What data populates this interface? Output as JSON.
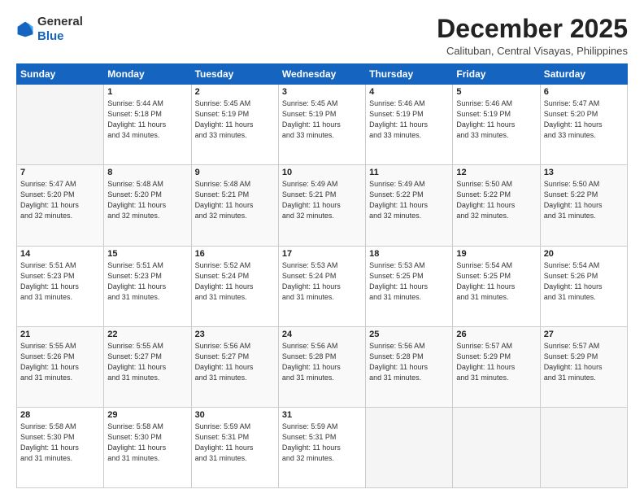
{
  "logo": {
    "general": "General",
    "blue": "Blue"
  },
  "title": "December 2025",
  "location": "Calituban, Central Visayas, Philippines",
  "days_header": [
    "Sunday",
    "Monday",
    "Tuesday",
    "Wednesday",
    "Thursday",
    "Friday",
    "Saturday"
  ],
  "weeks": [
    [
      {
        "day": "",
        "info": ""
      },
      {
        "day": "1",
        "info": "Sunrise: 5:44 AM\nSunset: 5:18 PM\nDaylight: 11 hours\nand 34 minutes."
      },
      {
        "day": "2",
        "info": "Sunrise: 5:45 AM\nSunset: 5:19 PM\nDaylight: 11 hours\nand 33 minutes."
      },
      {
        "day": "3",
        "info": "Sunrise: 5:45 AM\nSunset: 5:19 PM\nDaylight: 11 hours\nand 33 minutes."
      },
      {
        "day": "4",
        "info": "Sunrise: 5:46 AM\nSunset: 5:19 PM\nDaylight: 11 hours\nand 33 minutes."
      },
      {
        "day": "5",
        "info": "Sunrise: 5:46 AM\nSunset: 5:19 PM\nDaylight: 11 hours\nand 33 minutes."
      },
      {
        "day": "6",
        "info": "Sunrise: 5:47 AM\nSunset: 5:20 PM\nDaylight: 11 hours\nand 33 minutes."
      }
    ],
    [
      {
        "day": "7",
        "info": "Sunrise: 5:47 AM\nSunset: 5:20 PM\nDaylight: 11 hours\nand 32 minutes."
      },
      {
        "day": "8",
        "info": "Sunrise: 5:48 AM\nSunset: 5:20 PM\nDaylight: 11 hours\nand 32 minutes."
      },
      {
        "day": "9",
        "info": "Sunrise: 5:48 AM\nSunset: 5:21 PM\nDaylight: 11 hours\nand 32 minutes."
      },
      {
        "day": "10",
        "info": "Sunrise: 5:49 AM\nSunset: 5:21 PM\nDaylight: 11 hours\nand 32 minutes."
      },
      {
        "day": "11",
        "info": "Sunrise: 5:49 AM\nSunset: 5:22 PM\nDaylight: 11 hours\nand 32 minutes."
      },
      {
        "day": "12",
        "info": "Sunrise: 5:50 AM\nSunset: 5:22 PM\nDaylight: 11 hours\nand 32 minutes."
      },
      {
        "day": "13",
        "info": "Sunrise: 5:50 AM\nSunset: 5:22 PM\nDaylight: 11 hours\nand 31 minutes."
      }
    ],
    [
      {
        "day": "14",
        "info": "Sunrise: 5:51 AM\nSunset: 5:23 PM\nDaylight: 11 hours\nand 31 minutes."
      },
      {
        "day": "15",
        "info": "Sunrise: 5:51 AM\nSunset: 5:23 PM\nDaylight: 11 hours\nand 31 minutes."
      },
      {
        "day": "16",
        "info": "Sunrise: 5:52 AM\nSunset: 5:24 PM\nDaylight: 11 hours\nand 31 minutes."
      },
      {
        "day": "17",
        "info": "Sunrise: 5:53 AM\nSunset: 5:24 PM\nDaylight: 11 hours\nand 31 minutes."
      },
      {
        "day": "18",
        "info": "Sunrise: 5:53 AM\nSunset: 5:25 PM\nDaylight: 11 hours\nand 31 minutes."
      },
      {
        "day": "19",
        "info": "Sunrise: 5:54 AM\nSunset: 5:25 PM\nDaylight: 11 hours\nand 31 minutes."
      },
      {
        "day": "20",
        "info": "Sunrise: 5:54 AM\nSunset: 5:26 PM\nDaylight: 11 hours\nand 31 minutes."
      }
    ],
    [
      {
        "day": "21",
        "info": "Sunrise: 5:55 AM\nSunset: 5:26 PM\nDaylight: 11 hours\nand 31 minutes."
      },
      {
        "day": "22",
        "info": "Sunrise: 5:55 AM\nSunset: 5:27 PM\nDaylight: 11 hours\nand 31 minutes."
      },
      {
        "day": "23",
        "info": "Sunrise: 5:56 AM\nSunset: 5:27 PM\nDaylight: 11 hours\nand 31 minutes."
      },
      {
        "day": "24",
        "info": "Sunrise: 5:56 AM\nSunset: 5:28 PM\nDaylight: 11 hours\nand 31 minutes."
      },
      {
        "day": "25",
        "info": "Sunrise: 5:56 AM\nSunset: 5:28 PM\nDaylight: 11 hours\nand 31 minutes."
      },
      {
        "day": "26",
        "info": "Sunrise: 5:57 AM\nSunset: 5:29 PM\nDaylight: 11 hours\nand 31 minutes."
      },
      {
        "day": "27",
        "info": "Sunrise: 5:57 AM\nSunset: 5:29 PM\nDaylight: 11 hours\nand 31 minutes."
      }
    ],
    [
      {
        "day": "28",
        "info": "Sunrise: 5:58 AM\nSunset: 5:30 PM\nDaylight: 11 hours\nand 31 minutes."
      },
      {
        "day": "29",
        "info": "Sunrise: 5:58 AM\nSunset: 5:30 PM\nDaylight: 11 hours\nand 31 minutes."
      },
      {
        "day": "30",
        "info": "Sunrise: 5:59 AM\nSunset: 5:31 PM\nDaylight: 11 hours\nand 31 minutes."
      },
      {
        "day": "31",
        "info": "Sunrise: 5:59 AM\nSunset: 5:31 PM\nDaylight: 11 hours\nand 32 minutes."
      },
      {
        "day": "",
        "info": ""
      },
      {
        "day": "",
        "info": ""
      },
      {
        "day": "",
        "info": ""
      }
    ]
  ]
}
